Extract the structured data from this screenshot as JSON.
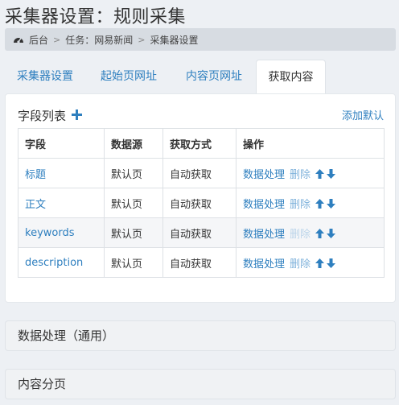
{
  "page": {
    "title": "采集器设置：规则采集"
  },
  "breadcrumb": {
    "items": [
      "后台",
      "任务：网易新闻",
      "采集器设置"
    ],
    "separator": ">"
  },
  "tabs": [
    {
      "label": "采集器设置",
      "active": false
    },
    {
      "label": "起始页网址",
      "active": false
    },
    {
      "label": "内容页网址",
      "active": false
    },
    {
      "label": "获取内容",
      "active": true
    }
  ],
  "field_list": {
    "title": "字段列表",
    "add_default": "添加默认",
    "headers": [
      "字段",
      "数据源",
      "获取方式",
      "操作"
    ],
    "rows": [
      {
        "field": "标题",
        "source": "默认页",
        "method": "自动获取",
        "process": "数据处理",
        "delete": "删除"
      },
      {
        "field": "正文",
        "source": "默认页",
        "method": "自动获取",
        "process": "数据处理",
        "delete": "删除"
      },
      {
        "field": "keywords",
        "source": "默认页",
        "method": "自动获取",
        "process": "数据处理",
        "delete": "删除"
      },
      {
        "field": "description",
        "source": "默认页",
        "method": "自动获取",
        "process": "数据处理",
        "delete": "删除"
      }
    ]
  },
  "sections": [
    {
      "label": "数据处理（通用）"
    },
    {
      "label": "内容分页"
    }
  ],
  "colors": {
    "link": "#2e7fbf",
    "arrow": "#2e7fbf",
    "breadcrumb_bg": "#d7dce2"
  },
  "icons": {
    "breadcrumb": "dashboard-icon",
    "add": "plus-icon",
    "up": "arrow-up-icon",
    "down": "arrow-down-icon"
  }
}
